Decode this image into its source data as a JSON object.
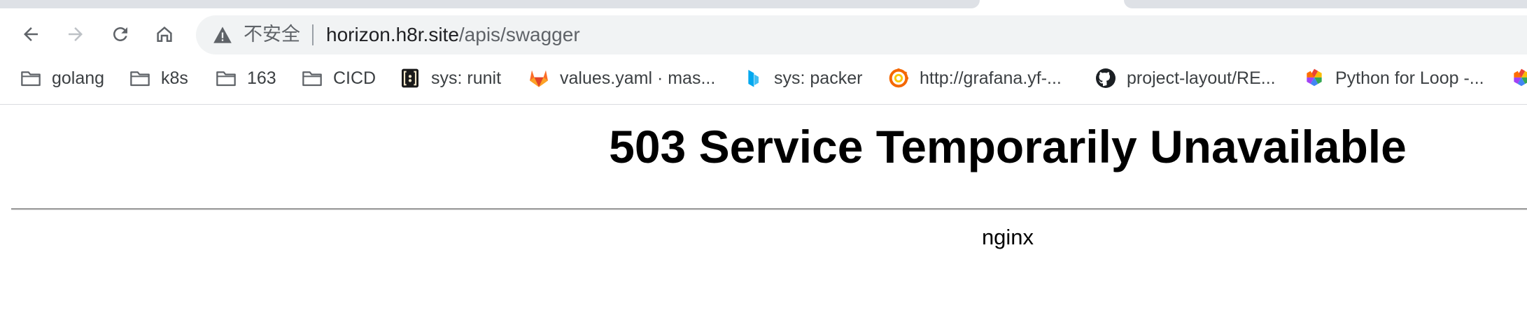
{
  "browser": {
    "omnibox": {
      "security_label": "不安全",
      "url_host": "horizon.h8r.site",
      "url_path": "/apis/swagger"
    },
    "icons": {
      "back": "back-arrow-icon",
      "forward": "forward-arrow-icon",
      "reload": "reload-icon",
      "home": "home-icon",
      "security": "warning-triangle-icon"
    },
    "bookmarks": [
      {
        "label": "golang",
        "icon": "folder-icon"
      },
      {
        "label": "k8s",
        "icon": "folder-icon"
      },
      {
        "label": "163",
        "icon": "folder-icon"
      },
      {
        "label": "CICD",
        "icon": "folder-icon"
      },
      {
        "label": "sys: runit",
        "icon": "runit-favicon"
      },
      {
        "label": "values.yaml · mas...",
        "icon": "gitlab-favicon"
      },
      {
        "label": "sys: packer",
        "icon": "packer-favicon"
      },
      {
        "label": "http://grafana.yf-...",
        "icon": "grafana-favicon"
      },
      {
        "label": "project-layout/RE...",
        "icon": "github-favicon"
      },
      {
        "label": "Python for Loop -...",
        "icon": "colorful-hexagon-favicon"
      }
    ]
  },
  "page": {
    "title": "503 Service Temporarily Unavailable",
    "server": "nginx"
  },
  "colors": {
    "tab_background": "#dee1e6",
    "omnibox_background": "#f1f3f4",
    "text_primary": "#202124",
    "text_secondary": "#5f6368",
    "gitlab_orange": "#e24329",
    "packer_blue": "#02a8ef",
    "grafana_orange": "#f46800"
  }
}
